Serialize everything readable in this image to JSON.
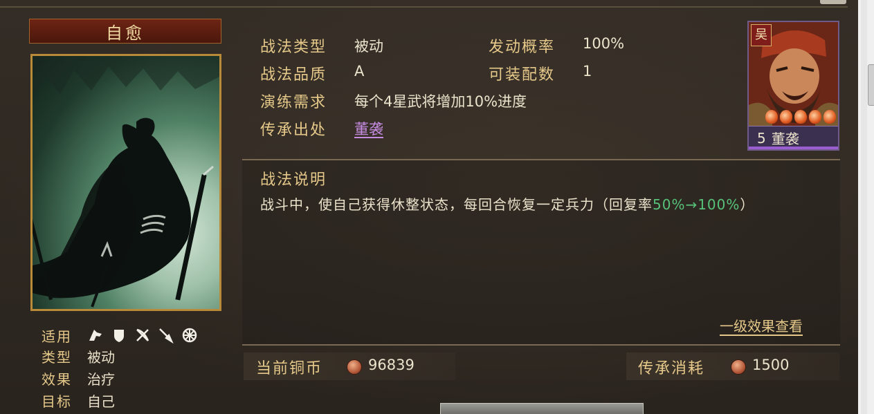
{
  "skill": {
    "name": "自愈"
  },
  "info": {
    "type_label": "战法类型",
    "type_value": "被动",
    "quality_label": "战法品质",
    "quality_value": "A",
    "drill_label": "演练需求",
    "drill_value": "每个4星武将增加10%进度",
    "source_label": "传承出处",
    "source_value": "董袭",
    "rate_label": "发动概率",
    "rate_value": "100%",
    "equip_label": "可装配数",
    "equip_value": "1"
  },
  "attributes": {
    "applicable_label": "适用",
    "applicable_icons": [
      "cavalry-icon",
      "shield-icon",
      "bow-icon",
      "spear-icon",
      "wheel-icon"
    ],
    "type_label": "类型",
    "type_value": "被动",
    "effect_label": "效果",
    "effect_value": "治疗",
    "target_label": "目标",
    "target_value": "自己"
  },
  "general": {
    "faction": "吴",
    "star": "5",
    "name": "董袭"
  },
  "description": {
    "title": "战法说明",
    "text": "战斗中，使自己获得休整状态，每回合恢复一定兵力（回复率",
    "highlight": "50%→100%",
    "text_end": "）",
    "level_link": "一级效果查看"
  },
  "currency": {
    "current_label": "当前铜币",
    "current_value": "96839",
    "cost_label": "传承消耗",
    "cost_value": "1500"
  },
  "colors": {
    "gold_label": "#e6c98a",
    "highlight_green": "#57c27a",
    "link_purple": "#c58be0"
  }
}
